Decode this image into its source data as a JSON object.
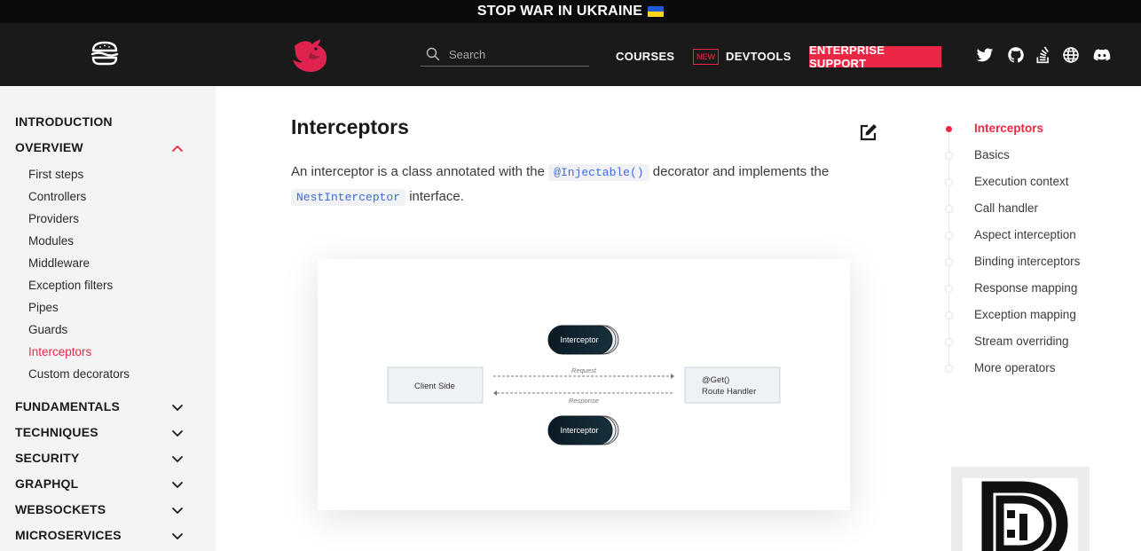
{
  "banner": {
    "text": "STOP WAR IN UKRAINE"
  },
  "header": {
    "search_placeholder": "Search",
    "courses": "COURSES",
    "new_badge": "NEW",
    "devtools": "DEVTOOLS",
    "enterprise": "ENTERPRISE SUPPORT",
    "social_icons": [
      "twitter-icon",
      "github-icon",
      "stackoverflow-icon",
      "globe-icon",
      "discord-icon"
    ],
    "accent": "#ea2845"
  },
  "sidebar": {
    "introduction": "INTRODUCTION",
    "overview": "OVERVIEW",
    "items": [
      "First steps",
      "Controllers",
      "Providers",
      "Modules",
      "Middleware",
      "Exception filters",
      "Pipes",
      "Guards",
      "Interceptors",
      "Custom decorators"
    ],
    "active_item": "Interceptors",
    "sections": [
      "FUNDAMENTALS",
      "TECHNIQUES",
      "SECURITY",
      "GRAPHQL",
      "WEBSOCKETS",
      "MICROSERVICES"
    ]
  },
  "main": {
    "title": "Interceptors",
    "para_1": "An interceptor is a class annotated with the ",
    "code_1": "@Injectable()",
    "para_2": " decorator and implements the",
    "code_2": "NestInterceptor",
    "para_3": " interface."
  },
  "diagram": {
    "client": "Client Side",
    "handler_1": "@Get()",
    "handler_2": "Route Handler",
    "interceptor": "Interceptor",
    "request": "Request",
    "response": "Response"
  },
  "toc": [
    "Interceptors",
    "Basics",
    "Execution context",
    "Call handler",
    "Aspect interception",
    "Binding interceptors",
    "Response mapping",
    "Exception mapping",
    "Stream overriding",
    "More operators"
  ]
}
